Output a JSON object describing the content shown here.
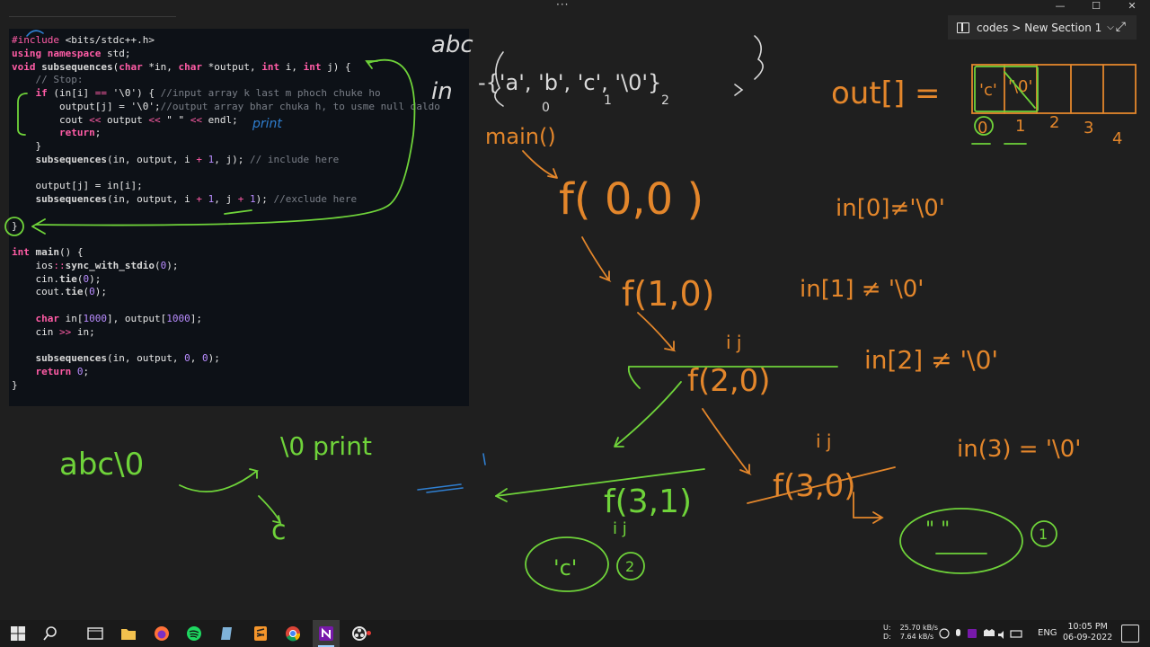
{
  "window": {
    "title_dots": "···",
    "minimize": "—",
    "maximize": "☐",
    "close": "✕"
  },
  "breadcrumb": {
    "notebook": "codes",
    "separator": ">",
    "section": "New Section 1",
    "chevron": "⌵",
    "expand": "⤢"
  },
  "code_lines": [
    "#include <bits/stdc++.h>",
    "using namespace std;",
    "void subsequences(char *in, char *output, int i, int j) {",
    "    // Stop:",
    "    if (in[i] == '\\0') { //input array k last m phoch chuke ho",
    "        output[j] = '\\0';//output array bhar chuka h, to usme null daldo",
    "        cout << output << \" \" << endl;",
    "        return;",
    "    }",
    "    subsequences(in, output, i + 1, j); // include here",
    "",
    "    output[j] = in[i];",
    "    subsequences(in, output, i + 1, j + 1); //exclude here",
    "",
    "}",
    "",
    "int main() {",
    "    ios::sync_with_stdio(0);",
    "    cin.tie(0);",
    "    cout.tie(0);",
    "",
    "    char in[1000], output[1000];",
    "    cin >> in;",
    "",
    "    subsequences(in, output, 0, 0);",
    "    return 0;",
    "}"
  ],
  "ink": {
    "abc_top": "abc",
    "in_label": "in",
    "in_array": "-{'a', 'b', 'c', '\\0'}",
    "in_indices": [
      "0",
      "1",
      "2"
    ],
    "main": "main()",
    "f00": "f( 0,0 )",
    "in0": "in[0]≠'\\0'",
    "f10": "f(1,0)",
    "in1": "in[1] ≠ '\\0'",
    "ij_1": "i  j",
    "f20": "f(2,0)",
    "in2": "in[2] ≠ '\\0'",
    "ij_2": "i  j",
    "f31": "f(3,1)",
    "ij_3": "i  j",
    "f30": "f(3,0)",
    "in3": "in(3) = '\\0'",
    "out_label": "out[] =",
    "out_cells": [
      "'c'",
      "'\\0'",
      "",
      "",
      "",
      ""
    ],
    "out_indices": [
      "0",
      "1",
      "2",
      "3",
      "4"
    ],
    "c_result": "'c'",
    "c_num": "2",
    "empty_result": "\" \"",
    "empty_num": "1",
    "print_blue": "print",
    "abc_green": "abc\\0",
    "print_green": "\\0  print",
    "c_green": "c"
  },
  "taskbar": {
    "net_up": "U:",
    "net_down": "D:",
    "rate_up": "25.70 kB/s",
    "rate_down": "7.64 kB/s",
    "lang": "ENG",
    "time": "10:05 PM",
    "date": "06-09-2022"
  },
  "colors": {
    "canvas": "#1f1f1f",
    "code_bg": "#0d1117",
    "ink_orange": "#e3862b",
    "ink_green": "#6fd33a",
    "ink_blue": "#2f7fd1"
  }
}
